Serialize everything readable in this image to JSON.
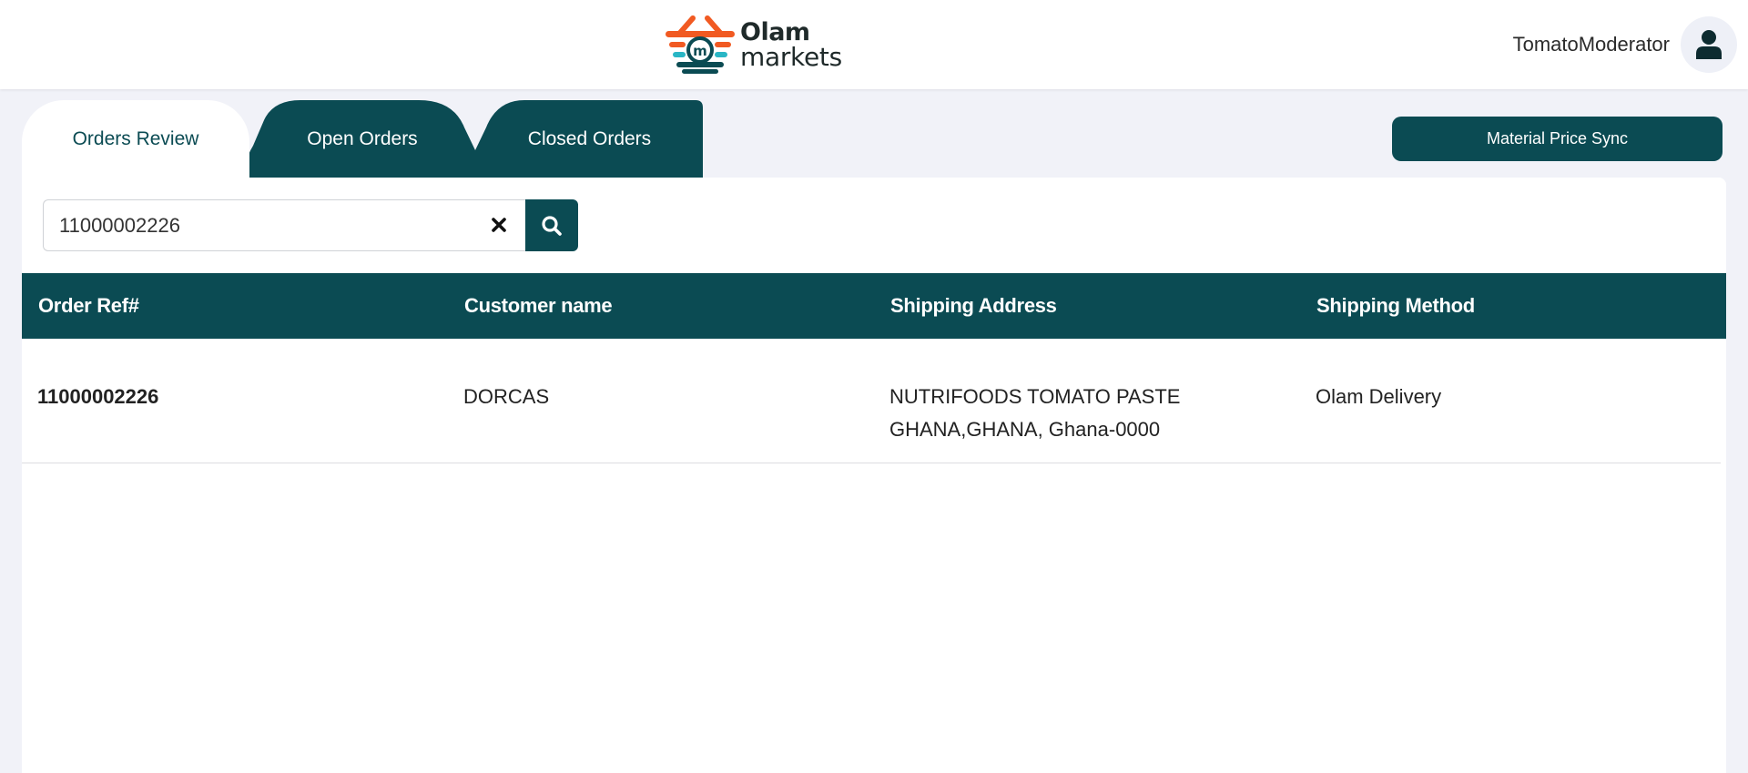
{
  "brand": {
    "line1": "Olam",
    "line2": "markets",
    "colors": {
      "orange": "#f15a22",
      "teal": "#0b4b53",
      "aqua": "#29b6c5"
    }
  },
  "user": {
    "name": "TomatoModerator",
    "avatar_icon": "user-icon"
  },
  "tabs": [
    {
      "label": "Orders Review",
      "active": true
    },
    {
      "label": "Open Orders",
      "active": false
    },
    {
      "label": "Closed Orders",
      "active": false
    }
  ],
  "actions": {
    "material_price_sync": "Material Price Sync"
  },
  "search": {
    "value": "11000002226",
    "clear_icon": "close-icon",
    "search_icon": "search-icon"
  },
  "table": {
    "headers": [
      "Order Ref#",
      "Customer name",
      "Shipping Address",
      "Shipping Method"
    ],
    "rows": [
      {
        "order_ref": "11000002226",
        "customer": "DORCAS",
        "address_line1": "NUTRIFOODS TOMATO PASTE",
        "address_line2": "GHANA,GHANA, Ghana-0000",
        "method": "Olam Delivery"
      }
    ]
  },
  "theme": {
    "primary": "#0b4b53",
    "background": "#f1f2f8"
  }
}
